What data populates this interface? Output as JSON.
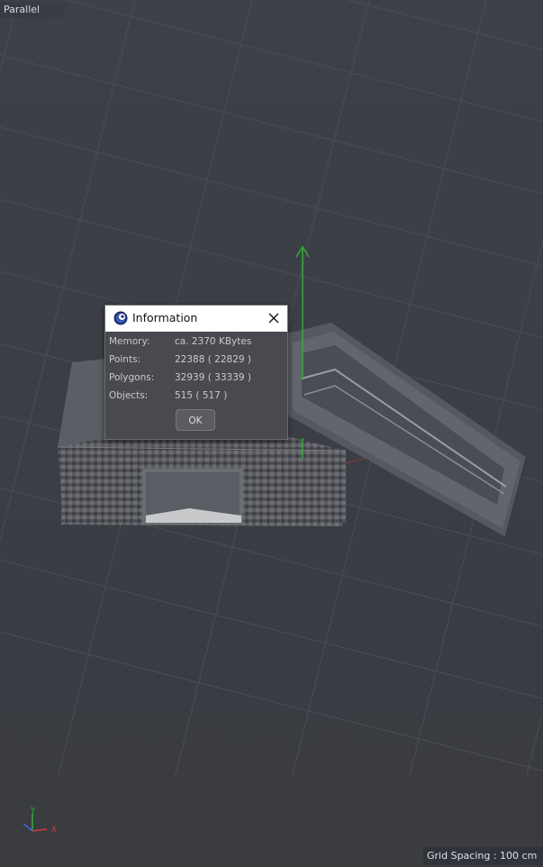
{
  "viewport": {
    "label": "Parallel",
    "grid_spacing": "Grid Spacing : 100 cm",
    "axis": {
      "x": "X",
      "y": "Y"
    }
  },
  "dialog": {
    "title": "Information",
    "icon": "cinema4d-logo-icon",
    "rows": [
      {
        "key": "Memory:",
        "value": "ca. 2370 KBytes"
      },
      {
        "key": "Points:",
        "value": "22388 ( 22829 )"
      },
      {
        "key": "Polygons:",
        "value": "32939 ( 33339 )"
      },
      {
        "key": "Objects:",
        "value": "515 ( 517 )"
      }
    ],
    "ok_label": "OK"
  },
  "colors": {
    "viewport_bg": "#3b3e45",
    "grid_line": "#4b4e55",
    "gizmo_y": "#2eae3a",
    "gizmo_x": "#d23a3a",
    "dialog_bg": "#484a4f",
    "titlebar": "#ffffff"
  }
}
